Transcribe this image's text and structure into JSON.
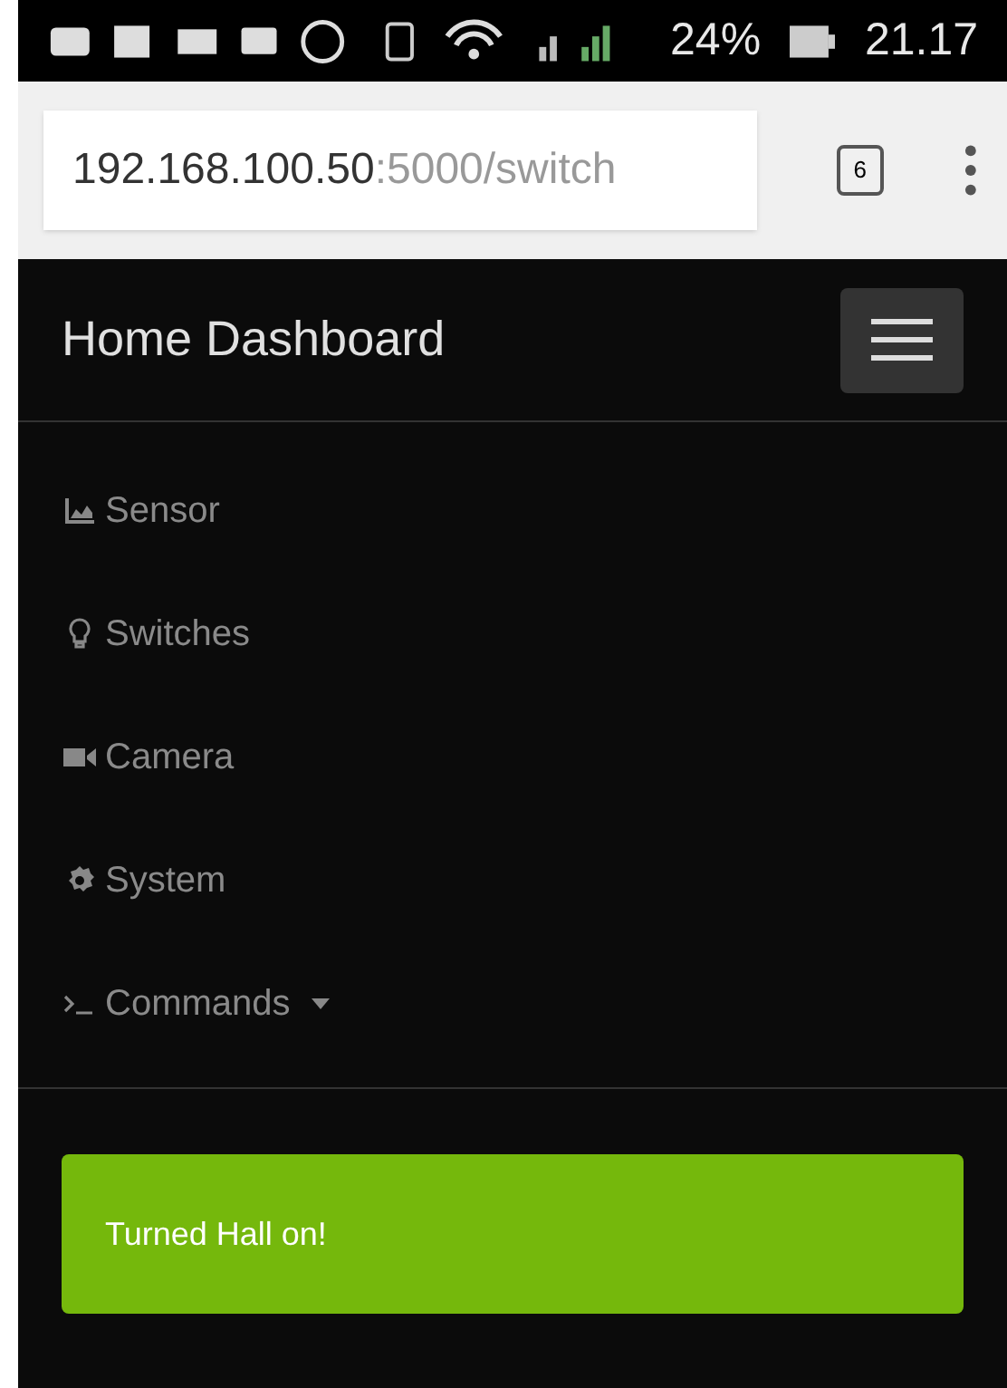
{
  "status_bar": {
    "battery": "24%",
    "time": "21.17"
  },
  "browser": {
    "url_host": "192.168.100.50",
    "url_path": ":5000/switch",
    "tab_count": "6"
  },
  "navbar": {
    "title": "Home Dashboard"
  },
  "menu": [
    {
      "label": "Sensor",
      "dropdown": false
    },
    {
      "label": "Switches",
      "dropdown": false
    },
    {
      "label": "Camera",
      "dropdown": false
    },
    {
      "label": "System",
      "dropdown": false
    },
    {
      "label": "Commands",
      "dropdown": true
    }
  ],
  "alert": {
    "text": "Turned Hall on!"
  }
}
